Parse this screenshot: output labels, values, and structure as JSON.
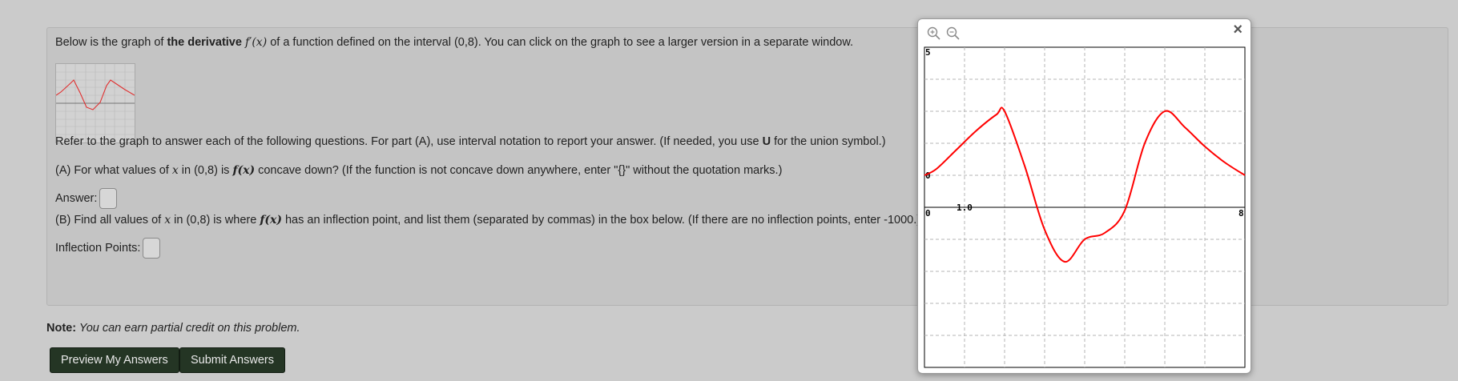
{
  "problem": {
    "intro": {
      "pre": "Below is the graph of ",
      "bold": "the derivative",
      "math": "f′(x)",
      "post": " of a function defined on the interval (0,8). You can click on the graph to see a larger version in a separate window."
    },
    "refer": {
      "pre": "Refer to the graph to answer each of the following questions. For part (A), use interval notation to report your answer. (If needed, you use ",
      "bold": "U",
      "post": " for the union symbol.)"
    },
    "partA": {
      "p1": "(A) For what values of ",
      "x": "x",
      "p2": " in (0,8) is ",
      "fx": "f(x)",
      "p3": " concave down? (If the function is not concave down anywhere, enter \"{}\" without the quotation marks.)"
    },
    "answer_label": "Answer:",
    "partB": {
      "p1": "(B) Find all values of ",
      "x": "x",
      "p2": " in (0,8) is where ",
      "fx": "f(x)",
      "p3": " has an inflection point, and list them (separated by commas) in the box below. (If there are no inflection points, enter -1000.)"
    },
    "inflection_label": "Inflection Points:"
  },
  "note": {
    "label": "Note:",
    "text": " You can earn partial credit on this problem."
  },
  "buttons": {
    "preview": "Preview My Answers",
    "submit": "Submit Answers"
  },
  "popup": {
    "close": "×",
    "zoom_in_icon": "zoom-in-icon",
    "zoom_out_icon": "zoom-out-icon",
    "close_icon": "close-icon"
  },
  "chart_data": {
    "type": "line",
    "title": "",
    "xlabel": "",
    "ylabel": "",
    "xlim": [
      0,
      8
    ],
    "ylim": [
      -5,
      5
    ],
    "grid": true,
    "grid_step": 1,
    "tick_labels": {
      "top_left": "5",
      "axis_left": "0",
      "origin": "0",
      "right": "8",
      "scale": "1.0"
    },
    "series": [
      {
        "color": "#ff0000",
        "x": [
          0,
          0.3,
          0.8,
          1.3,
          1.8,
          2.0,
          2.5,
          3.0,
          3.5,
          4.0,
          4.5,
          5.0,
          5.5,
          6.0,
          6.5,
          7.0,
          7.5,
          8.0
        ],
        "y": [
          1.0,
          1.2,
          1.8,
          2.4,
          2.9,
          3.0,
          1.3,
          -0.7,
          -1.7,
          -1.0,
          -0.8,
          -0.1,
          2.0,
          3.0,
          2.5,
          1.9,
          1.4,
          1.0
        ]
      }
    ]
  }
}
